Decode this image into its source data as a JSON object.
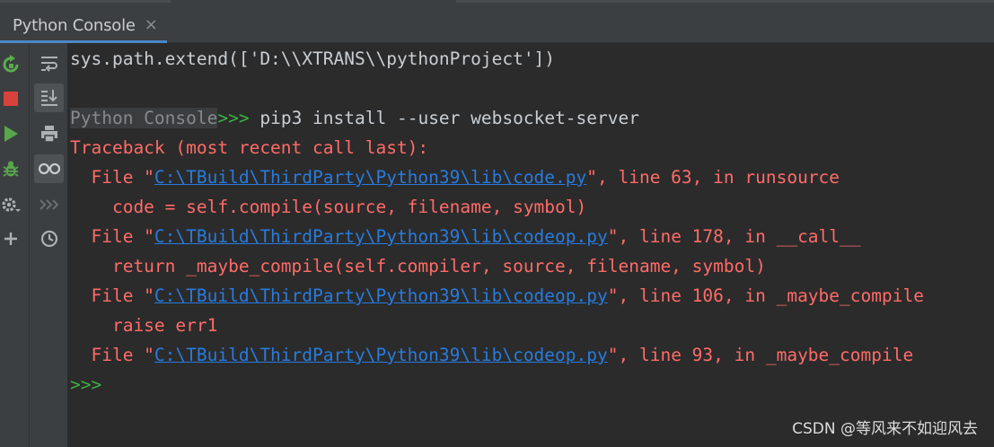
{
  "tab": {
    "label": "Python Console",
    "close_glyph": "×"
  },
  "toolbar_left": [
    {
      "name": "rerun-icon"
    },
    {
      "name": "stop-icon"
    },
    {
      "name": "run-icon"
    },
    {
      "name": "debug-icon"
    },
    {
      "name": "settings-icon"
    },
    {
      "name": "add-icon"
    }
  ],
  "toolbar_right": [
    {
      "name": "soft-wrap-icon"
    },
    {
      "name": "scroll-to-end-icon",
      "active": true
    },
    {
      "name": "print-icon"
    },
    {
      "name": "show-variables-icon",
      "active": true
    },
    {
      "name": "execute-icon"
    },
    {
      "name": "history-icon"
    }
  ],
  "console": {
    "line1": "sys.path.extend(['D:\\\\XTRANS\\\\pythonProject'])",
    "prompt_label": "Python Console",
    "prompt_gt": ">>>",
    "command": " pip3 install --user websocket-server",
    "traceback_header": "Traceback (most recent call last):",
    "frames": [
      {
        "prefix": "  File \"",
        "path": "C:\\TBuild\\ThirdParty\\Python39\\lib\\code.py",
        "suffix": "\", line 63, in runsource",
        "code": "    code = self.compile(source, filename, symbol)"
      },
      {
        "prefix": "  File \"",
        "path": "C:\\TBuild\\ThirdParty\\Python39\\lib\\codeop.py",
        "suffix": "\", line 178, in __call__",
        "code": "    return _maybe_compile(self.compiler, source, filename, symbol)"
      },
      {
        "prefix": "  File \"",
        "path": "C:\\TBuild\\ThirdParty\\Python39\\lib\\codeop.py",
        "suffix": "\", line 106, in _maybe_compile",
        "code": "    raise err1"
      },
      {
        "prefix": "  File \"",
        "path": "C:\\TBuild\\ThirdParty\\Python39\\lib\\codeop.py",
        "suffix": "\", line 93, in _maybe_compile"
      }
    ],
    "final_prompt": ">>>"
  },
  "watermark": "CSDN @等风来不如迎风去",
  "colors": {
    "error": "#ff6b68",
    "link": "#287bde",
    "prompt": "#3bb243",
    "accent": "#4a88c7"
  }
}
